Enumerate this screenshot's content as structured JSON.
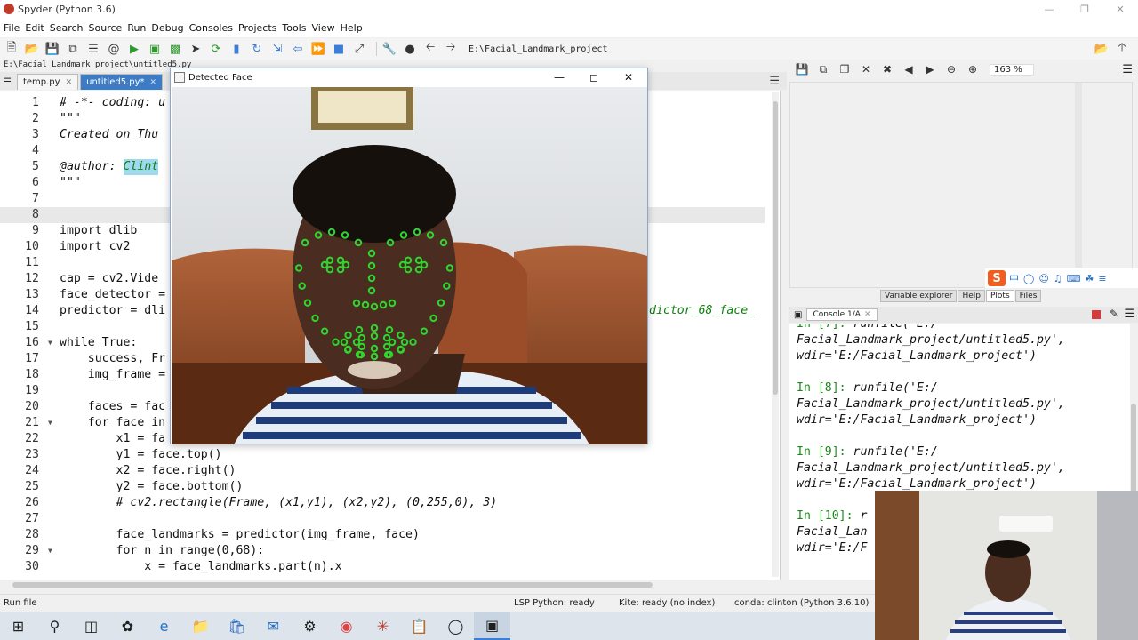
{
  "window": {
    "title": "Spyder (Python 3.6)"
  },
  "menu": [
    "File",
    "Edit",
    "Search",
    "Source",
    "Run",
    "Debug",
    "Consoles",
    "Projects",
    "Tools",
    "View",
    "Help"
  ],
  "toolbar": {
    "working_dir": "E:\\Facial_Landmark_project"
  },
  "editor": {
    "file_path": "E:\\Facial_Landmark_project\\untitled5.py",
    "tabs": [
      {
        "label": "temp.py"
      },
      {
        "label": "untitled5.py*"
      }
    ],
    "current_line": "8",
    "lines": [
      {
        "n": "1",
        "code": "# -*- coding: u"
      },
      {
        "n": "2",
        "code": "\"\"\""
      },
      {
        "n": "3",
        "code": "Created on Thu"
      },
      {
        "n": "4",
        "code": ""
      },
      {
        "n": "5",
        "code": "@author: ",
        "sel": "Clint"
      },
      {
        "n": "6",
        "code": "\"\"\""
      },
      {
        "n": "7",
        "code": ""
      },
      {
        "n": "8",
        "code": ""
      },
      {
        "n": "9",
        "code": "import dlib"
      },
      {
        "n": "10",
        "code": "import cv2"
      },
      {
        "n": "11",
        "code": ""
      },
      {
        "n": "12",
        "code": "cap = cv2.Vide"
      },
      {
        "n": "13",
        "code": "face_detector ="
      },
      {
        "n": "14",
        "code": "predictor = dli",
        "tail": "dictor_68_face_"
      },
      {
        "n": "15",
        "code": ""
      },
      {
        "n": "16",
        "code": "while True:"
      },
      {
        "n": "17",
        "code": "    success, Fr"
      },
      {
        "n": "18",
        "code": "    img_frame ="
      },
      {
        "n": "19",
        "code": ""
      },
      {
        "n": "20",
        "code": "    faces = fac"
      },
      {
        "n": "21",
        "code": "    for face in"
      },
      {
        "n": "22",
        "code": "        x1 = fa"
      },
      {
        "n": "23",
        "code": "        y1 = face.top()"
      },
      {
        "n": "24",
        "code": "        x2 = face.right()"
      },
      {
        "n": "25",
        "code": "        y2 = face.bottom()"
      },
      {
        "n": "26",
        "code": "        # cv2.rectangle(Frame, (x1,y1), (x2,y2), (0,255,0), 3)"
      },
      {
        "n": "27",
        "code": ""
      },
      {
        "n": "28",
        "code": "        face_landmarks = predictor(img_frame, face)"
      },
      {
        "n": "29",
        "code": "        for n in range(0,68):"
      },
      {
        "n": "30",
        "code": "            x = face_landmarks.part(n).x"
      }
    ]
  },
  "plots": {
    "zoom": "163 %",
    "tabs": [
      "Variable explorer",
      "Help",
      "Plots",
      "Files"
    ]
  },
  "console": {
    "tab": "Console 1/A",
    "lines": [
      {
        "prompt": "In [7]:",
        "text": " runfile('E:/"
      },
      {
        "text": "Facial_Landmark_project/untitled5.py',"
      },
      {
        "text": "wdir='E:/Facial_Landmark_project')"
      },
      {
        "text": ""
      },
      {
        "prompt": "In [8]:",
        "text": " runfile('E:/"
      },
      {
        "text": "Facial_Landmark_project/untitled5.py',"
      },
      {
        "text": "wdir='E:/Facial_Landmark_project')"
      },
      {
        "text": ""
      },
      {
        "prompt": "In [9]:",
        "text": " runfile('E:/"
      },
      {
        "text": "Facial_Landmark_project/untitled5.py',"
      },
      {
        "text": "wdir='E:/Facial_Landmark_project')"
      },
      {
        "text": ""
      },
      {
        "prompt": "In [10]:",
        "text": " r"
      },
      {
        "text": "Facial_Lan"
      },
      {
        "text": "wdir='E:/F"
      }
    ]
  },
  "status": {
    "hint": "Run file",
    "lsp": "LSP Python: ready",
    "kite": "Kite: ready (no index)",
    "conda": "conda: clinton (Python 3.6.10)"
  },
  "face_window": {
    "title": "Detected Face"
  },
  "colors": {
    "accent": "#3c7bc6",
    "landmark": "#2fd62f",
    "prompt": "#1d8a1d"
  },
  "taskbar_icons": [
    "windows-start-icon",
    "search-icon",
    "task-view-icon",
    "app-icon",
    "edge-icon",
    "file-explorer-icon",
    "store-icon",
    "mail-icon",
    "settings-icon",
    "chrome-icon",
    "spyder-icon",
    "notepad-icon",
    "anaconda-icon",
    "terminal-icon"
  ]
}
